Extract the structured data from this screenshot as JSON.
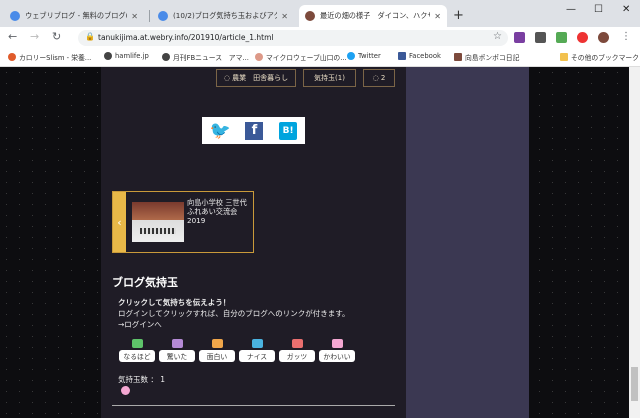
{
  "tabs": [
    {
      "title": "ウェブリブログ - 無料のブログ(blog)サ",
      "color": "#4a8be8"
    },
    {
      "title": "(10/2)ブログ気持ち玉およびアクセス",
      "color": "#4a8be8"
    },
    {
      "title": "最近の畑の様子　ダイコン、ハクサイ",
      "color": "#7d4a3c"
    }
  ],
  "browser": {
    "url": "tanukijima.at.webry.info/201910/article_1.html",
    "new_tab": "+",
    "minimize": "—",
    "maximize": "☐",
    "close": "✕"
  },
  "bookmarks": [
    {
      "label": "カロリーSlism - 栄養..."
    },
    {
      "label": "hamlife.jp"
    },
    {
      "label": "月刊FBニュース　アマ..."
    },
    {
      "label": "マイクロウェーブ山口の..."
    },
    {
      "label": "Twitter"
    },
    {
      "label": "Facebook"
    },
    {
      "label": "向島ポンポコ日記"
    },
    {
      "label": "その他のブックマーク"
    }
  ],
  "article_nav": [
    {
      "label": "◌ 農業　田舎暮らし"
    },
    {
      "label": "気持玉(1)"
    },
    {
      "label": "◌ 2"
    }
  ],
  "share": {
    "twitter": "twitter-icon",
    "facebook": "f",
    "hatena": "B!"
  },
  "related": {
    "arrow": "‹",
    "title": "向島小学校 三世代ふれあい交流会 2019"
  },
  "kimochi": {
    "heading": "ブログ気持玉",
    "prompt": "クリックして気持ちを伝えよう！",
    "login_text": "ログインしてクリックすれば、自分のブログへのリンクが付きます。",
    "login_link": "→ログインへ",
    "buttons": [
      {
        "label": "なるほど",
        "color": "#5ec36a"
      },
      {
        "label": "驚いた",
        "color": "#b58ad6"
      },
      {
        "label": "面白い",
        "color": "#f0a64a"
      },
      {
        "label": "ナイス",
        "color": "#4ab3e0"
      },
      {
        "label": "ガッツ",
        "color": "#ea6f6f"
      },
      {
        "label": "かわいい",
        "color": "#f4a7d2"
      }
    ],
    "count_label": "気持玉数 ：",
    "count": "1"
  }
}
